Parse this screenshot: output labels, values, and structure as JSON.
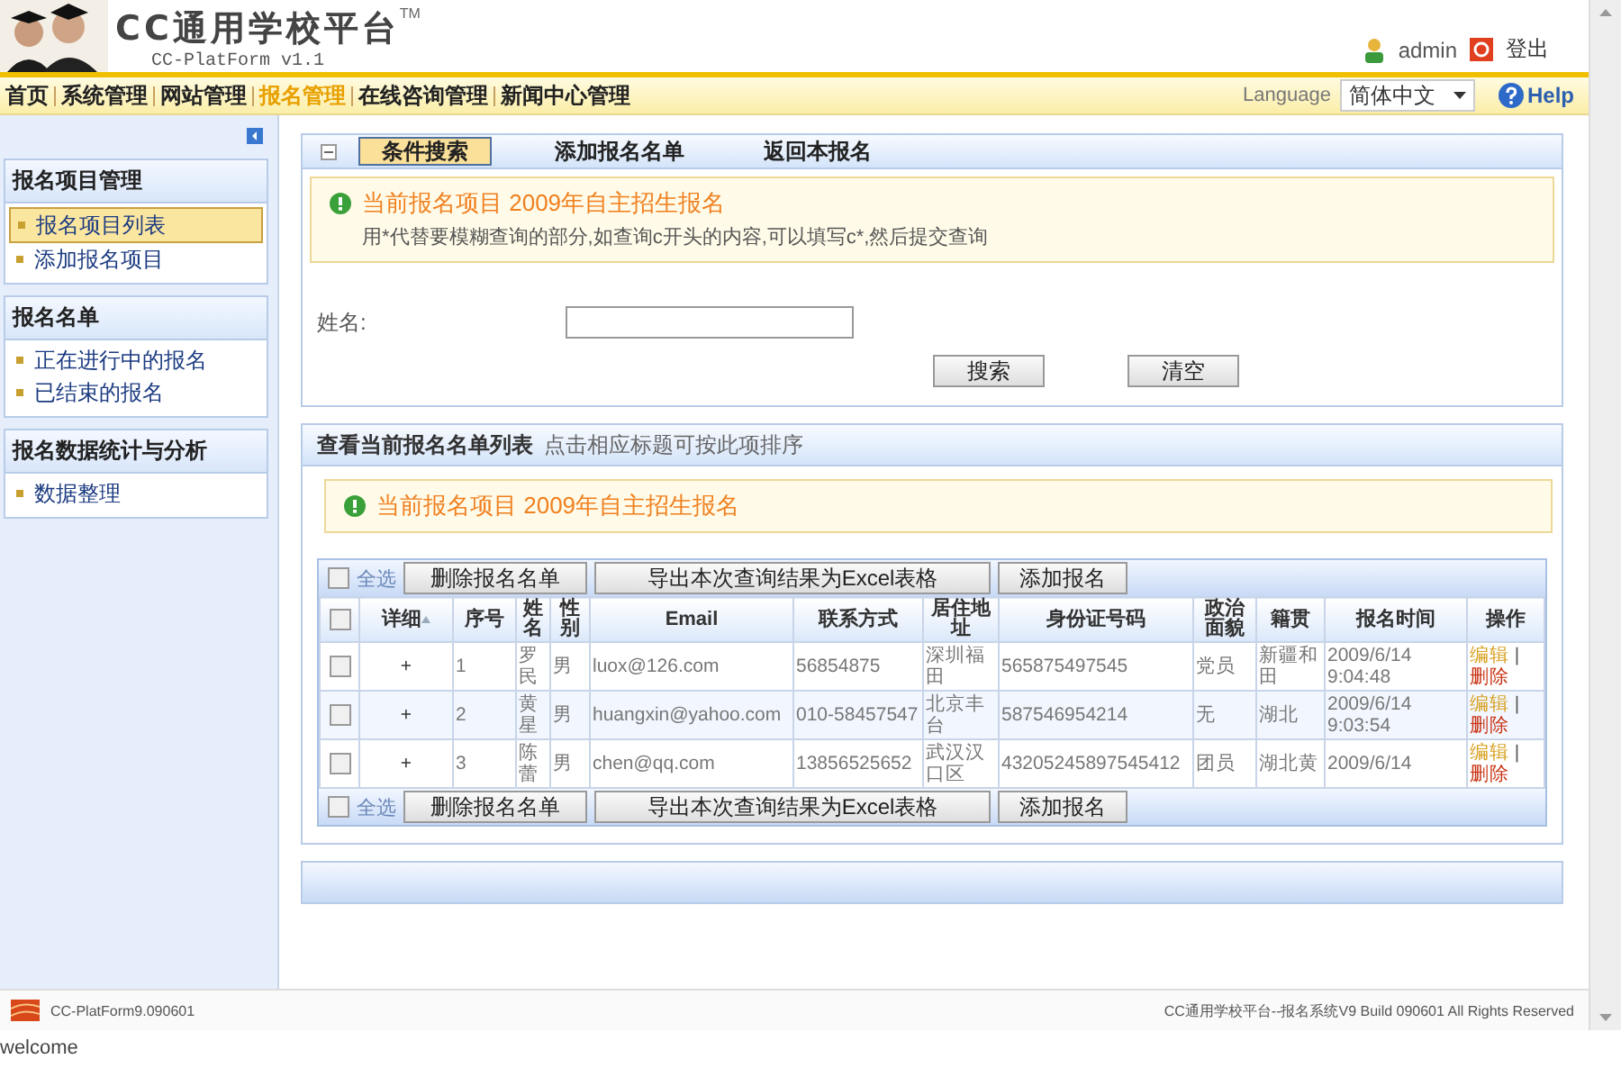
{
  "header": {
    "logo_title": "CC通用学校平台",
    "logo_tm": "TM",
    "logo_sub": "CC-PlatForm v1.1",
    "user": "admin",
    "logout": "登出"
  },
  "nav": {
    "items": [
      {
        "label": "首页",
        "selected": false
      },
      {
        "label": "系统管理",
        "selected": false
      },
      {
        "label": "网站管理",
        "selected": false
      },
      {
        "label": "报名管理",
        "selected": true
      },
      {
        "label": "在线咨询管理",
        "selected": false
      },
      {
        "label": "新闻中心管理",
        "selected": false
      }
    ],
    "language_label": "Language",
    "language_value": "简体中文",
    "help": "Help"
  },
  "sidebar": {
    "sections": [
      {
        "title": "报名项目管理",
        "items": [
          {
            "label": "报名项目列表",
            "selected": true
          },
          {
            "label": "添加报名项目",
            "selected": false
          }
        ]
      },
      {
        "title": "报名名单",
        "items": [
          {
            "label": "正在进行中的报名",
            "selected": false
          },
          {
            "label": "已结束的报名",
            "selected": false
          }
        ]
      },
      {
        "title": "报名数据统计与分析",
        "items": [
          {
            "label": "数据整理",
            "selected": false
          }
        ]
      }
    ]
  },
  "search_panel": {
    "tabs": [
      {
        "label": "条件搜索",
        "selected": true
      },
      {
        "label": "添加报名名单",
        "selected": false
      },
      {
        "label": "返回本报名",
        "selected": false
      }
    ],
    "notice": {
      "title": "当前报名项目 2009年自主招生报名",
      "hint": "用*代替要模糊查询的部分,如查询c开头的内容,可以填写c*,然后提交查询"
    },
    "field": {
      "label": "姓名:"
    },
    "buttons": [
      "搜索",
      "清空"
    ]
  },
  "list_panel": {
    "title": "查看当前报名名单列表",
    "hint": "点击相应标题可按此项排序",
    "notice": {
      "title": "当前报名项目 2009年自主招生报名"
    },
    "toolbar": {
      "select_all": "全选",
      "checked": false,
      "buttons": [
        "删除报名名单",
        "导出本次查询结果为Excel表格",
        "添加报名"
      ]
    },
    "columns": [
      "详细",
      "序号",
      "姓名",
      "性别",
      "Email",
      "联系方式",
      "居住地址",
      "身份证号码",
      "政治面貌",
      "籍贯",
      "报名时间",
      "操作"
    ],
    "header_checked": false,
    "rows": [
      {
        "checked": false,
        "cells": [
          "+",
          "1",
          "罗民",
          "男",
          "luox@126.com",
          "56854875",
          "深圳福田",
          "565875497545",
          "党员",
          "新疆和田",
          "2009/6/14 9:04:48"
        ],
        "edit": "编辑",
        "separator": "|",
        "delete": "删除"
      },
      {
        "checked": false,
        "cells": [
          "+",
          "2",
          "黄星",
          "男",
          "huangxin@yahoo.com",
          "010-58457547",
          "北京丰台",
          "587546954214",
          "无",
          "湖北",
          "2009/6/14 9:03:54"
        ],
        "edit": "编辑",
        "separator": "|",
        "delete": "删除"
      },
      {
        "checked": false,
        "cells": [
          "+",
          "3",
          "陈蕾",
          "男",
          "chen@qq.com",
          "13856525652",
          "武汉汉口区",
          "43205245897545412",
          "团员",
          "湖北黄",
          "2009/6/14"
        ],
        "edit": "编辑",
        "separator": "|",
        "delete": "删除"
      }
    ],
    "bottom_toolbar": {
      "select_all": "全选",
      "checked": false,
      "buttons": [
        "删除报名名单",
        "导出本次查询结果为Excel表格",
        "添加报名"
      ]
    }
  },
  "footer": {
    "left": "CC-PlatForm9.090601",
    "right": "CC通用学校平台--报名系统V9 Build 090601 All Rights Reserved"
  },
  "status": "welcome"
}
